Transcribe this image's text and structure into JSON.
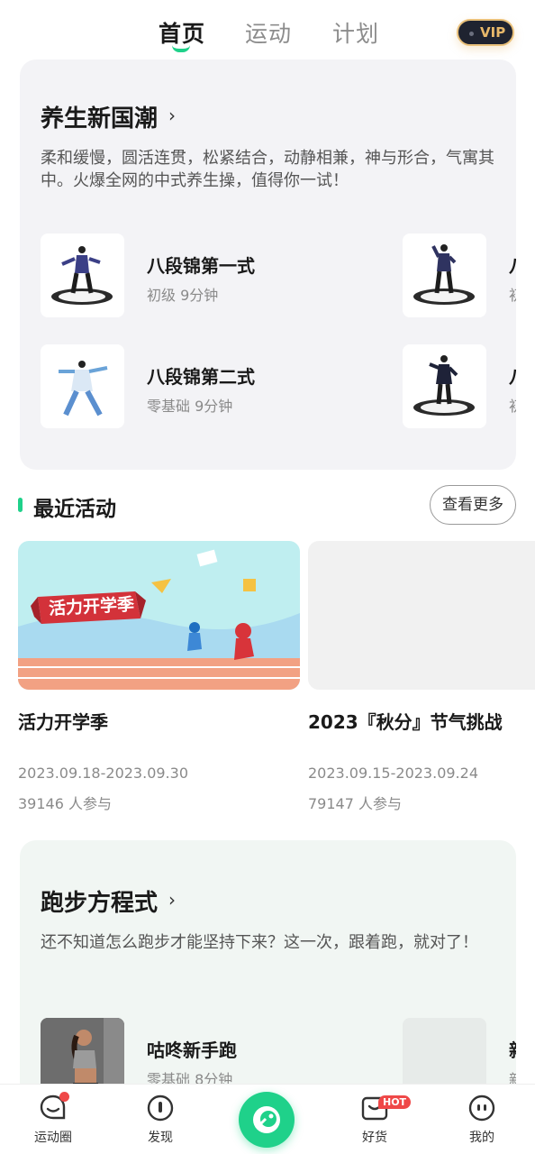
{
  "top_tabs": [
    {
      "label": "首页",
      "active": true
    },
    {
      "label": "运动",
      "active": false
    },
    {
      "label": "计划",
      "active": false
    }
  ],
  "vip_badge": "VIP",
  "wellness_card": {
    "title": "养生新国潮",
    "description": "柔和缓慢，圆活连贯，松紧结合，动静相兼，神与形合，气寓其中。火爆全网的中式养生操，值得你一试！",
    "items": [
      {
        "title": "八段锦第一式",
        "subtitle": "初级 9分钟"
      },
      {
        "title": "八段锦第二式",
        "subtitle": "零基础 9分钟"
      }
    ],
    "clipped_items": [
      {
        "title": "八",
        "subtitle": "初"
      },
      {
        "title": "八",
        "subtitle": "初"
      }
    ]
  },
  "recent_activities": {
    "title": "最近活动",
    "more_label": "查看更多",
    "banner_text": "活力开学季",
    "items": [
      {
        "title": "活力开学季",
        "date": "2023.09.18-2023.09.30",
        "participants": "39146 人参与"
      },
      {
        "title": "2023『秋分』节气挑战",
        "date": "2023.09.15-2023.09.24",
        "participants": "79147 人参与"
      }
    ]
  },
  "running_card": {
    "title": "跑步方程式",
    "description": "还不知道怎么跑步才能坚持下来？这一次，跟着跑，就对了！",
    "items": [
      {
        "title": "咕咚新手跑",
        "subtitle": "零基础 8分钟"
      }
    ],
    "clipped_items": [
      {
        "title": "新",
        "subtitle": "新"
      }
    ]
  },
  "bottom_nav": {
    "items": [
      {
        "label": "运动圈",
        "icon": "chat-bubble-icon"
      },
      {
        "label": "发现",
        "icon": "compass-icon"
      },
      {
        "label": "",
        "icon": "codoon-logo-icon"
      },
      {
        "label": "好货",
        "icon": "shop-bag-icon"
      },
      {
        "label": "我的",
        "icon": "profile-face-icon"
      }
    ],
    "hot_badge": "HOT"
  },
  "colors": {
    "accent": "#1fd18a",
    "badge_red": "#ef4848",
    "vip_bg": "#1f2330",
    "vip_gold": "#e8b86a"
  }
}
